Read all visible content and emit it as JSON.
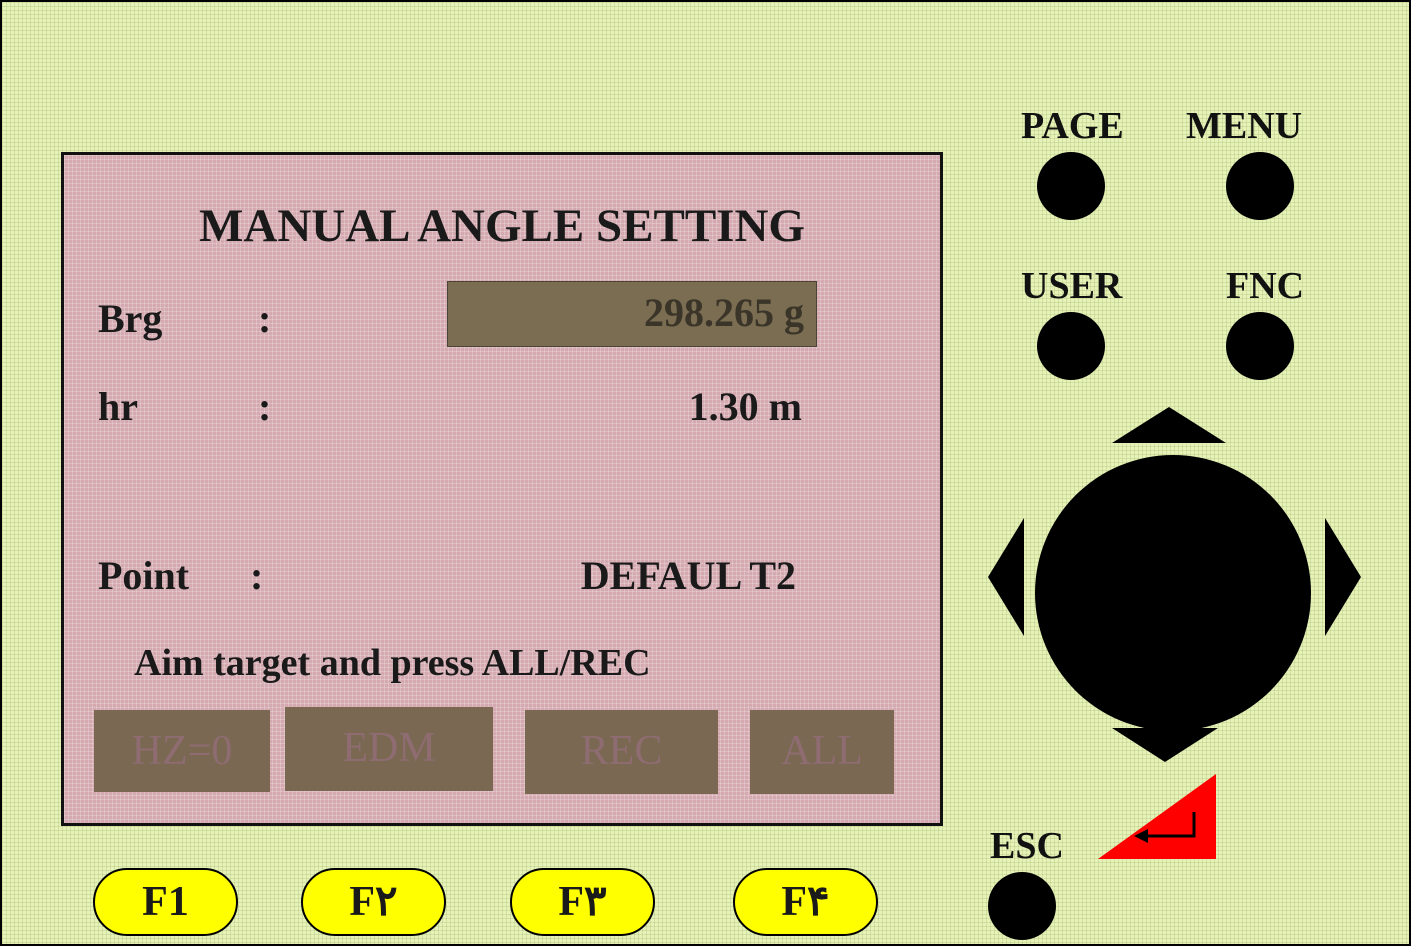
{
  "screen": {
    "title": "MANUAL ANGLE SETTING",
    "fields": [
      {
        "label": "Brg",
        "colon": ":",
        "value": "298.265 g"
      },
      {
        "label": "hr",
        "colon": ":",
        "value": "1.30 m"
      },
      {
        "label": "Point",
        "colon": ":",
        "value": "DEFAUL T2"
      }
    ],
    "message": "Aim target and press ALL/REC",
    "softkeys": [
      "HZ=0",
      "EDM",
      "REC",
      "ALL"
    ]
  },
  "keypad": {
    "page_label": "PAGE",
    "menu_label": "MENU",
    "user_label": "USER",
    "fnc_label": "FNC",
    "esc_label": "ESC",
    "enter_icon": "enter-icon"
  },
  "function_keys": [
    "F1",
    "F۲",
    "F۳",
    "F۴"
  ],
  "colors": {
    "background": "#e6f3b8",
    "screen": "#d4aab0",
    "function_key": "#ffff00",
    "enter_key": "#ff0000"
  }
}
